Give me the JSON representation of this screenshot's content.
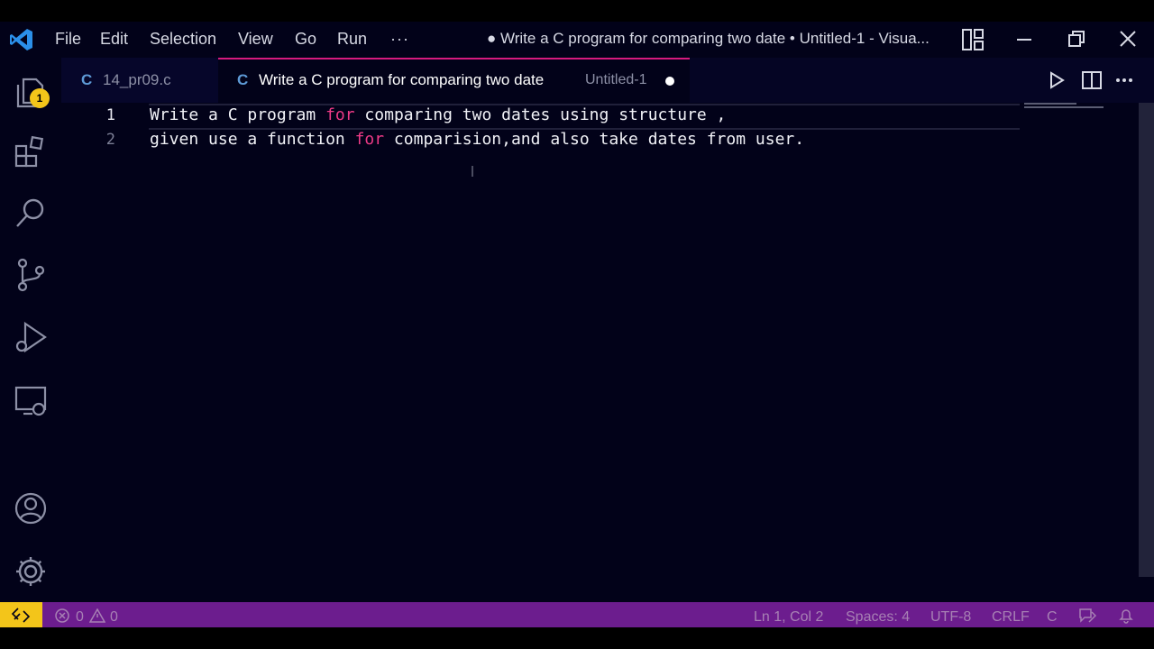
{
  "window": {
    "title": "● Write a C program for comparing two date • Untitled-1 - Visua...",
    "menu": [
      "File",
      "Edit",
      "Selection",
      "View",
      "Go",
      "Run",
      "···"
    ]
  },
  "activity_bar": {
    "explorer_badge": "1",
    "icons": [
      "files-icon",
      "extensions-icon",
      "search-icon",
      "source-control-icon",
      "run-debug-icon",
      "remote-explorer-icon",
      "account-icon",
      "settings-gear-icon"
    ]
  },
  "tabs": [
    {
      "icon": "C",
      "label": "14_pr09.c",
      "description": ""
    },
    {
      "icon": "C",
      "label": "Write a C program for comparing two date",
      "description": "Untitled-1",
      "dirty": true
    }
  ],
  "editor": {
    "lines": [
      {
        "number": "1",
        "parts": [
          "Write a C program ",
          "for",
          " comparing two dates using structure ,"
        ]
      },
      {
        "number": "2",
        "parts": [
          "given use a function ",
          "for",
          " comparision,and also take dates from user."
        ]
      }
    ]
  },
  "status": {
    "errors": "0",
    "warnings": "0",
    "position": "Ln 1, Col 2",
    "spaces": "Spaces: 4",
    "encoding": "UTF-8",
    "eol": "CRLF",
    "language": "C"
  },
  "colors": {
    "background": "#020219",
    "status_bar": "#6c1d8e",
    "remote_indicator": "#f3c51a",
    "keyword": "#ec3a86",
    "tab_accent": "#d61a7f",
    "vscode_logo": "#2b8fe8"
  }
}
